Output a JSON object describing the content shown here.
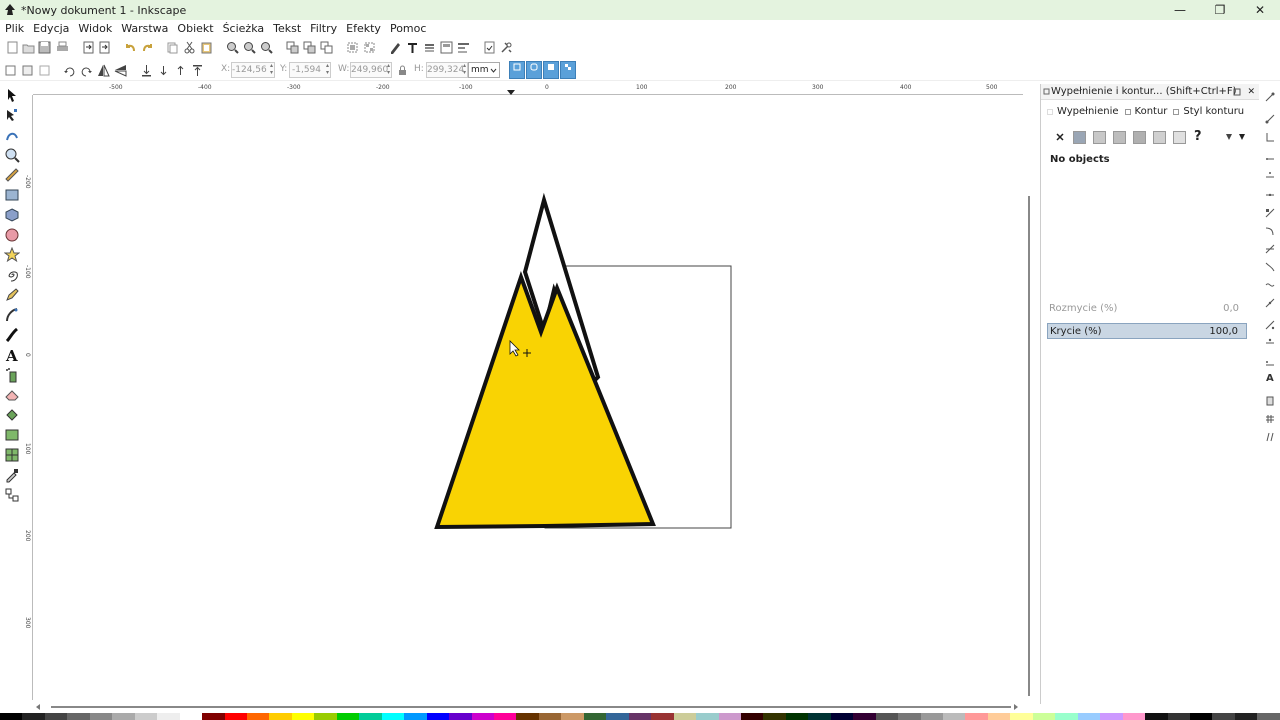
{
  "window": {
    "title": "*Nowy dokument 1 - Inkscape",
    "min_label": "—",
    "max_label": "❐",
    "close_label": "✕"
  },
  "menu": [
    "Plik",
    "Edycja",
    "Widok",
    "Warstwa",
    "Obiekt",
    "Ścieżka",
    "Tekst",
    "Filtry",
    "Efekty",
    "Pomoc"
  ],
  "controls": {
    "x_label": "X:",
    "x_value": "-124,56",
    "y_label": "Y:",
    "y_value": "-1,594",
    "w_label": "W:",
    "w_value": "249,960",
    "h_label": "H:",
    "h_value": "299,324",
    "unit": "mm"
  },
  "ruler": {
    "h_labels": [
      "-500",
      "-400",
      "-300",
      "-200",
      "-100",
      "0",
      "100",
      "200",
      "300",
      "400",
      "500"
    ],
    "v_labels": [
      "-200",
      "-100",
      "0",
      "100",
      "200",
      "300"
    ]
  },
  "dock": {
    "title": "Wypełnienie i kontur... (Shift+Ctrl+F)",
    "tabs": [
      "Wypełnienie",
      "Kontur",
      "Styl konturu"
    ],
    "no_objects": "No objects",
    "blur_label": "Rozmycie (%)",
    "blur_value": "0,0",
    "opacity_label": "Krycie (%)",
    "opacity_value": "100,0",
    "unset_symbol": "?"
  },
  "colors": {
    "titlebar": "#e4f3df",
    "mountain_fill": "#f9d303",
    "stroke": "#111111"
  }
}
